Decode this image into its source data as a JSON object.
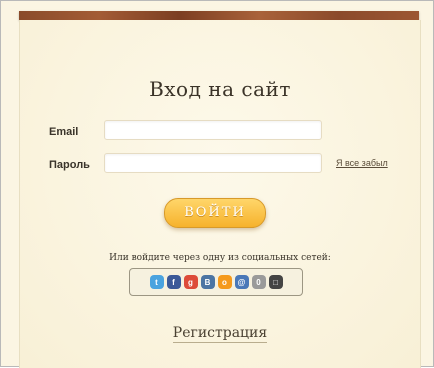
{
  "login": {
    "title": "Вход на сайт",
    "email_label": "Email",
    "email_value": "",
    "password_label": "Пароль",
    "password_value": "",
    "forgot_link": "Я все забыл",
    "submit_label": "ВОЙТИ",
    "social_caption": "Или войдите через одну из социальных сетей:",
    "register_link": "Регистрация"
  },
  "social": [
    {
      "icon": "twitter-icon",
      "glyph": "t",
      "color": "#4aa3df"
    },
    {
      "icon": "facebook-icon",
      "glyph": "f",
      "color": "#3b5998"
    },
    {
      "icon": "google-icon",
      "glyph": "g",
      "color": "#dd4b39"
    },
    {
      "icon": "vkontakte-icon",
      "glyph": "B",
      "color": "#4c75a3"
    },
    {
      "icon": "odnoklassniki-icon",
      "glyph": "o",
      "color": "#f59a1c"
    },
    {
      "icon": "mailru-icon",
      "glyph": "@",
      "color": "#4a78b8"
    },
    {
      "icon": "openid-icon",
      "glyph": "0",
      "color": "#9a9a9a"
    },
    {
      "icon": "livejournal-icon",
      "glyph": "□",
      "color": "#444444"
    }
  ]
}
